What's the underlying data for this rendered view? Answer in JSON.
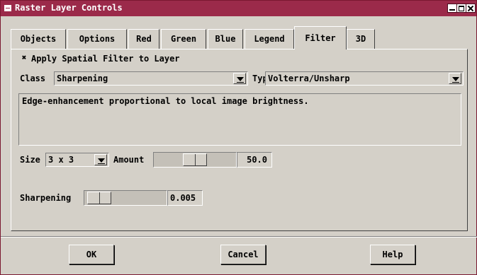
{
  "window": {
    "title": "Raster Layer Controls"
  },
  "tabs": [
    {
      "label": "Objects"
    },
    {
      "label": "Options"
    },
    {
      "label": "Red"
    },
    {
      "label": "Green"
    },
    {
      "label": "Blue"
    },
    {
      "label": "Legend"
    },
    {
      "label": "Filter",
      "active": true
    },
    {
      "label": "3D"
    }
  ],
  "filter": {
    "apply_checked": true,
    "apply_mark": "✖",
    "apply_label": "Apply Spatial Filter to Layer",
    "class_label": "Class",
    "class_value": "Sharpening",
    "type_label": "Type",
    "type_value": "Volterra/Unsharp",
    "description": "Edge-enhancement proportional to local image brightness.",
    "size_label": "Size",
    "size_value": "3 x 3",
    "amount_label": "Amount",
    "amount_value": "50.0",
    "amount_fraction": 0.5,
    "sharpening_label": "Sharpening",
    "sharpening_value": "0.005",
    "sharpening_fraction": 0.05
  },
  "buttons": {
    "ok": "OK",
    "cancel": "Cancel",
    "help": "Help"
  }
}
